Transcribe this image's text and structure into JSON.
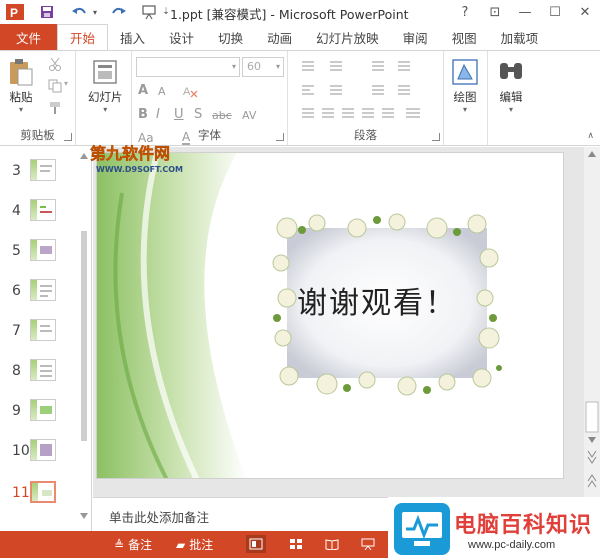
{
  "titlebar": {
    "title": "1.ppt [兼容模式] - Microsoft PowerPoint",
    "help": "?",
    "controls": [
      "⊡",
      "—",
      "☐",
      "✕"
    ]
  },
  "tabs": [
    "文件",
    "开始",
    "插入",
    "设计",
    "切换",
    "动画",
    "幻灯片放映",
    "审阅",
    "视图",
    "加载项"
  ],
  "ribbon": {
    "clipboard": {
      "paste": "粘贴",
      "label": "剪贴板"
    },
    "slides": {
      "new_slide": "幻灯片",
      "label": ""
    },
    "font": {
      "size": "60",
      "label": "字体",
      "letters": [
        "B",
        "I",
        "U",
        "S",
        "abc",
        "AV",
        "Aa",
        "A",
        "A"
      ]
    },
    "paragraph": {
      "label": "段落"
    },
    "drawing": {
      "label": "绘图"
    },
    "editing": {
      "label": "编辑"
    }
  },
  "thumbnails": [
    {
      "num": "3"
    },
    {
      "num": "4"
    },
    {
      "num": "5"
    },
    {
      "num": "6"
    },
    {
      "num": "7"
    },
    {
      "num": "8"
    },
    {
      "num": "9"
    },
    {
      "num": "10"
    },
    {
      "num": "11"
    }
  ],
  "slide": {
    "text": "谢谢观看！"
  },
  "notes": {
    "placeholder": "单击此处添加备注"
  },
  "status": {
    "notes": "备注",
    "comments": "批注"
  },
  "watermarks": {
    "top_cn": "第九软件网",
    "top_url": "WWW.D9SOFT.COM",
    "bottom_cn": "电脑百科知识",
    "bottom_url": "www.pc-daily.com"
  },
  "colors": {
    "accent": "#d24726",
    "green": "#8cc063"
  }
}
